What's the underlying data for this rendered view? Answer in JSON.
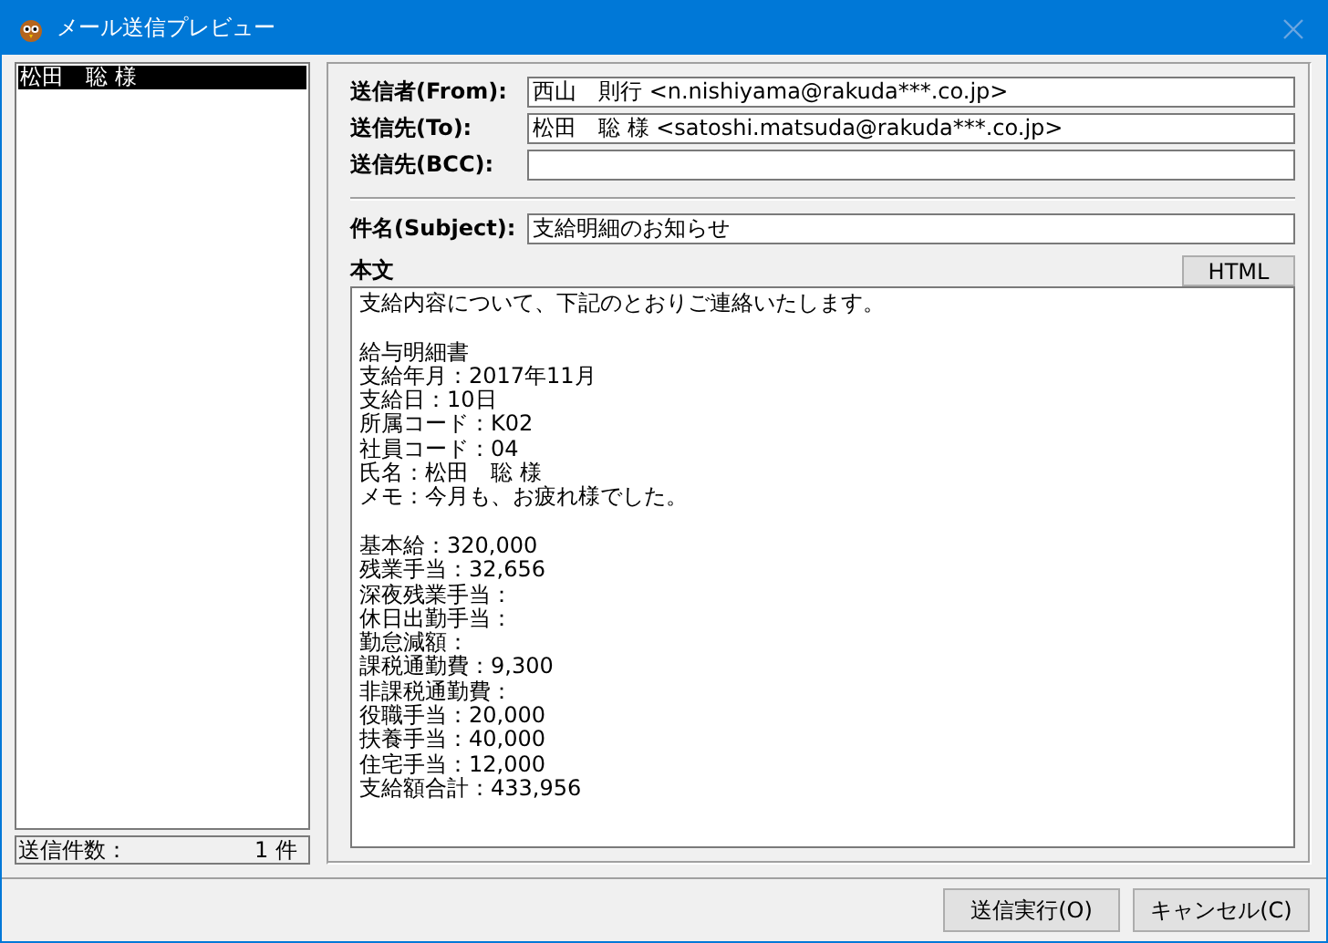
{
  "window": {
    "title": "メール送信プレビュー"
  },
  "recipients": [
    {
      "name": "松田　聡 様",
      "selected": true
    }
  ],
  "count": {
    "label": "送信件数：",
    "value": "1 件"
  },
  "header_fields": [
    {
      "label": "送信者(From):",
      "value": "西山　則行 <n.nishiyama@rakuda***.co.jp>"
    },
    {
      "label": "送信先(To):",
      "value": "松田　聡 様 <satoshi.matsuda@rakuda***.co.jp>"
    },
    {
      "label": "送信先(BCC):"
    }
  ],
  "subject": {
    "label": "件名(Subject):",
    "value": "支給明細のお知らせ"
  },
  "body": {
    "label": "本文",
    "html_button": "HTML",
    "paragraphs": [
      [
        "支給内容について、下記のとおりご連絡いたします。"
      ],
      [
        "給与明細書",
        "支給年月：2017年11月",
        "支給日：10日",
        "所属コード：K02",
        "社員コード：04",
        "氏名：松田　聡 様",
        "メモ：今月も、お疲れ様でした。"
      ],
      [
        "基本給：320,000",
        "残業手当：32,656",
        "深夜残業手当：",
        "休日出勤手当：",
        "勤怠減額：",
        "課税通勤費：9,300",
        "非課税通勤費：",
        "役職手当：20,000",
        "扶養手当：40,000",
        "住宅手当：12,000",
        "支給額合計：433,956"
      ]
    ]
  },
  "buttons": [
    "送信実行(O)",
    "キャンセル(C)"
  ]
}
